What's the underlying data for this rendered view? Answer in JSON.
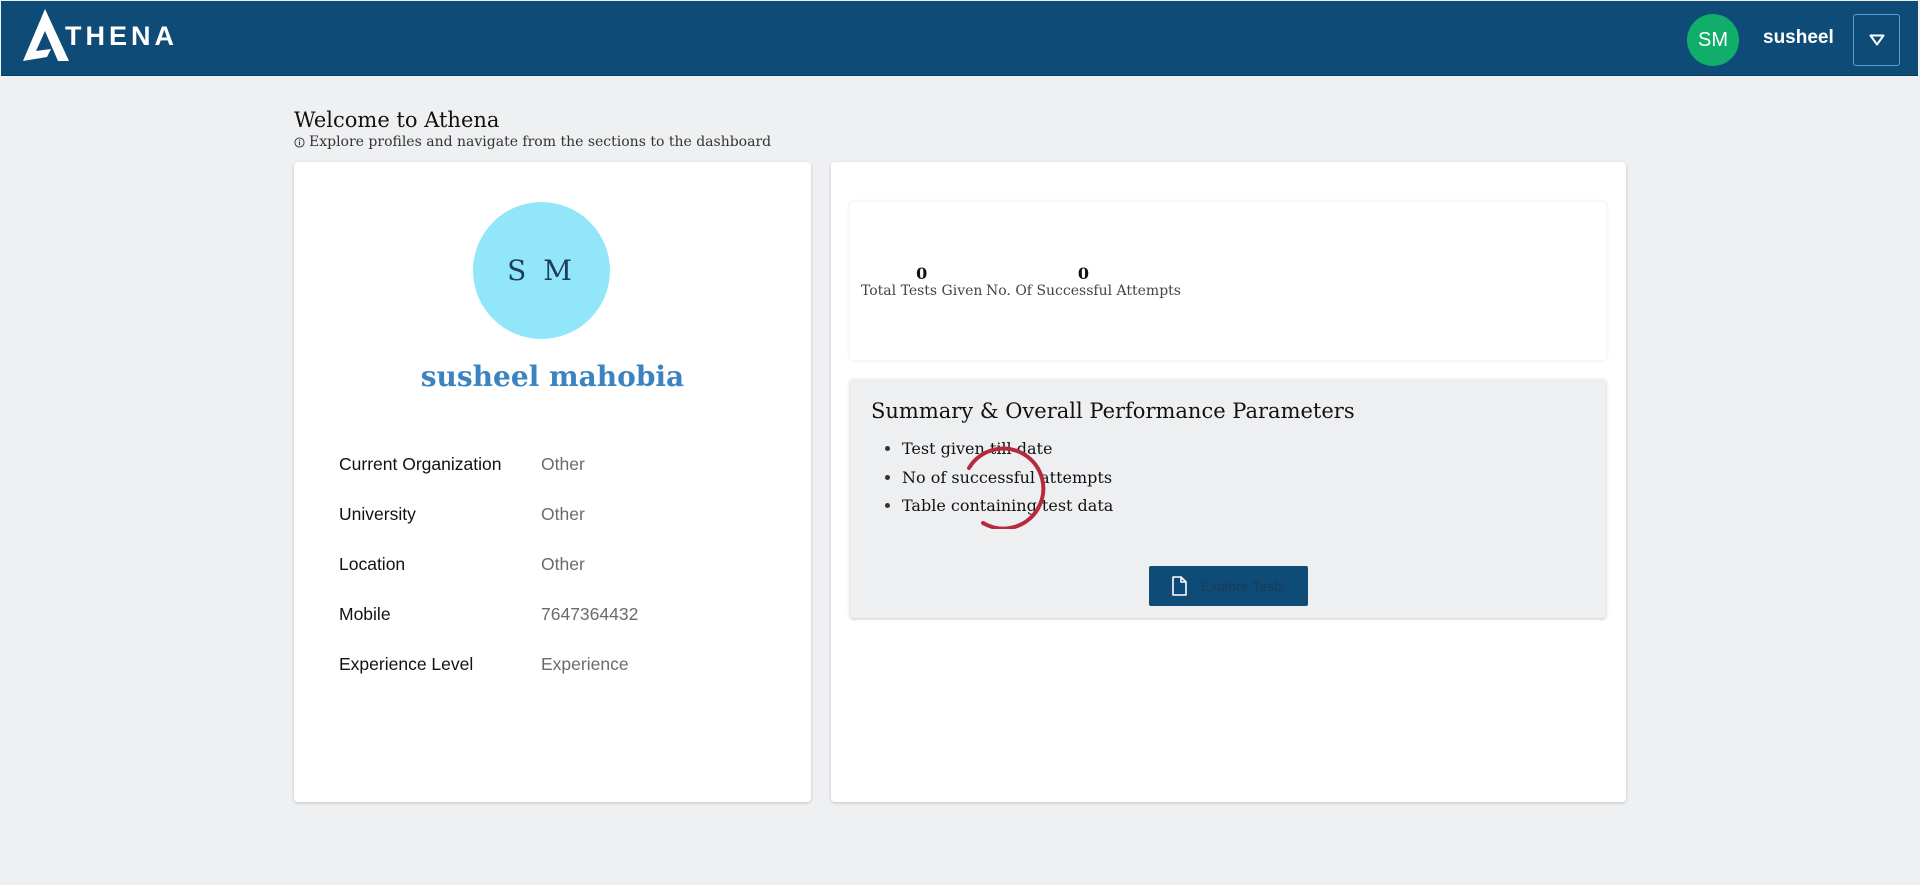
{
  "header": {
    "logo_text": "THENA",
    "user_initials": "SM",
    "user_name": "susheel",
    "dropdown_icon": "caret-down-icon"
  },
  "welcome": {
    "title": "Welcome to Athena",
    "subtitle": "Explore profiles and navigate from the sections to the dashboard",
    "subtitle_icon": "info-icon"
  },
  "profile": {
    "initials": "S M",
    "name": "susheel mahobia",
    "fields": [
      {
        "label": "Current Organization",
        "value": "Other"
      },
      {
        "label": "University",
        "value": "Other"
      },
      {
        "label": "Location",
        "value": "Other"
      },
      {
        "label": "Mobile",
        "value": "7647364432"
      },
      {
        "label": "Experience Level",
        "value": "Experience"
      }
    ]
  },
  "stats": [
    {
      "value": "0",
      "label": "Total Tests Given"
    },
    {
      "value": "0",
      "label": "No. Of Successful Attempts"
    }
  ],
  "summary": {
    "title": "Summary & Overall Performance Parameters",
    "items": [
      "Test given till date",
      "No of successful attempts",
      "Table containing test data"
    ],
    "button_label": "Explore Tests",
    "button_icon": "document-icon",
    "loading_indicator": "spinner-icon"
  },
  "colors": {
    "header_bg": "#0e4c77",
    "page_bg": "#eff0f2",
    "user_avatar_bg": "#10ae6a",
    "profile_avatar_bg": "#92e6fa",
    "profile_name": "#3b83c1",
    "spinner": "#b52a3c"
  }
}
